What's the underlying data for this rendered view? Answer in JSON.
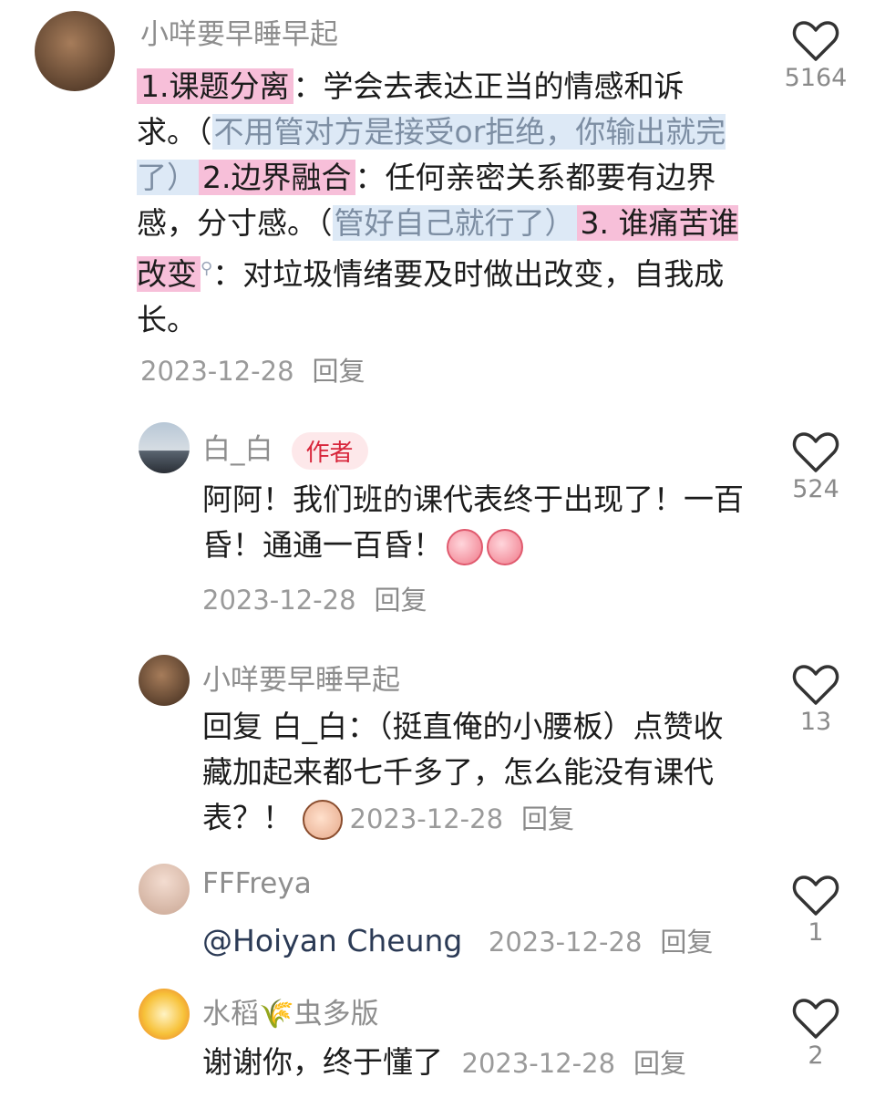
{
  "comments": [
    {
      "username": "小咩要早睡早起",
      "likes": "5164",
      "seg": {
        "p1": "1.课题分离",
        "t1": "：学会去表达正当的情感和诉求。（",
        "b1": "不用管对方是接受or拒绝，你输出就完了）",
        "p2": "2.边界融合",
        "t2": "：任何亲密关系都要有边界感，分寸感。（",
        "b2": "管好自己就行了）",
        "p3": "3. 谁痛苦谁改变",
        "t3": "：对垃圾情绪要及时做出改变，自我成长。"
      },
      "date": "2023-12-28",
      "reply": "回复"
    },
    {
      "username": "白_白",
      "badge": "作者",
      "likes": "524",
      "text": "阿阿！我们班的课代表终于出现了！一百昏！通通一百昏！",
      "date": "2023-12-28",
      "reply": "回复"
    },
    {
      "username": "小咩要早睡早起",
      "likes": "13",
      "text": "回复 白_白：（挺直俺的小腰板）点赞收藏加起来都七千多了，怎么能没有课代表？！",
      "date": "2023-12-28",
      "reply": "回复"
    },
    {
      "username": "FFFreya",
      "likes": "1",
      "text": "@Hoiyan Cheung",
      "date": "2023-12-28",
      "reply": "回复"
    },
    {
      "username": "水稻🌾虫多版",
      "likes": "2",
      "text": "谢谢你，终于懂了",
      "date": "2023-12-28",
      "reply": "回复"
    }
  ],
  "icons": {
    "like": "heart-outline-icon",
    "thumb_emoji": "thumbs-up-emoji-icon",
    "face_emoji": "smirk-face-emoji-icon",
    "search_mark": "search-icon"
  },
  "colors": {
    "highlight_pink": "#f7bfd9",
    "highlight_blue": "#dde9f6",
    "badge_red": "#d8263b"
  }
}
